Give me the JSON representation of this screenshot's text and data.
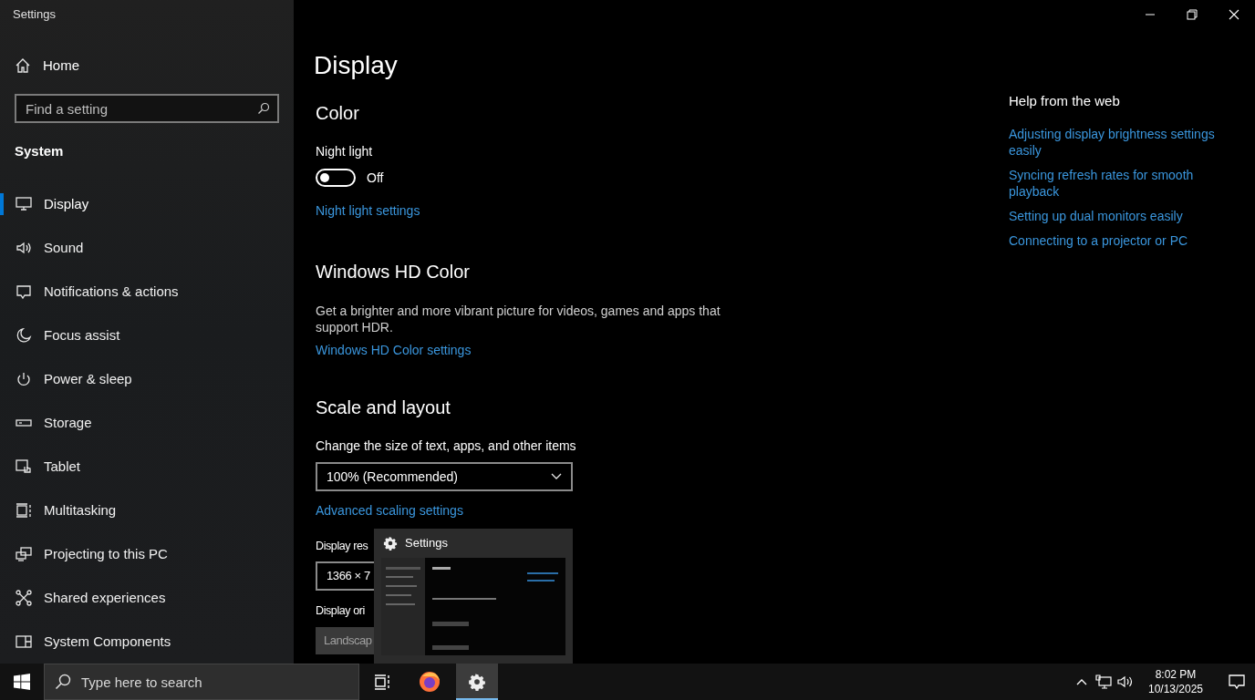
{
  "window": {
    "title": "Settings"
  },
  "sidebar": {
    "home": "Home",
    "search": {
      "placeholder": "Find a setting"
    },
    "section": "System",
    "items": [
      {
        "kind": "display",
        "label": "Display",
        "selected": true
      },
      {
        "kind": "sound",
        "label": "Sound",
        "selected": false
      },
      {
        "kind": "notifications",
        "label": "Notifications & actions",
        "selected": false
      },
      {
        "kind": "focus",
        "label": "Focus assist",
        "selected": false
      },
      {
        "kind": "power",
        "label": "Power & sleep",
        "selected": false
      },
      {
        "kind": "storage",
        "label": "Storage",
        "selected": false
      },
      {
        "kind": "tablet",
        "label": "Tablet",
        "selected": false
      },
      {
        "kind": "multitasking",
        "label": "Multitasking",
        "selected": false
      },
      {
        "kind": "projecting",
        "label": "Projecting to this PC",
        "selected": false
      },
      {
        "kind": "shared",
        "label": "Shared experiences",
        "selected": false
      },
      {
        "kind": "components",
        "label": "System Components",
        "selected": false
      }
    ]
  },
  "page": {
    "title": "Display",
    "color": {
      "heading": "Color",
      "night_light": {
        "label": "Night light",
        "on": false,
        "state_text": "Off"
      },
      "link": "Night light settings"
    },
    "hd_color": {
      "heading": "Windows HD Color",
      "description": "Get a brighter and more vibrant picture for videos, games and apps that support HDR.",
      "link": "Windows HD Color settings"
    },
    "scale": {
      "heading": "Scale and layout",
      "size_label": "Change the size of text, apps, and other items",
      "size_value": "100% (Recommended)",
      "link": "Advanced scaling settings",
      "resolution_label": "Display res",
      "resolution_value": "1366 × 7",
      "orientation_label": "Display ori",
      "orientation_value": "Landscap"
    }
  },
  "help": {
    "heading": "Help from the web",
    "links": [
      "Adjusting display brightness settings easily",
      "Syncing refresh rates for smooth playback",
      "Setting up dual monitors easily",
      "Connecting to a projector or PC"
    ]
  },
  "preview": {
    "title": "Settings"
  },
  "taskbar": {
    "search": {
      "placeholder": "Type here to search"
    },
    "apps": [
      {
        "kind": "browser",
        "active": false
      },
      {
        "kind": "settings",
        "active": true
      }
    ],
    "time": "8:02 PM",
    "date": "10/13/2025"
  }
}
